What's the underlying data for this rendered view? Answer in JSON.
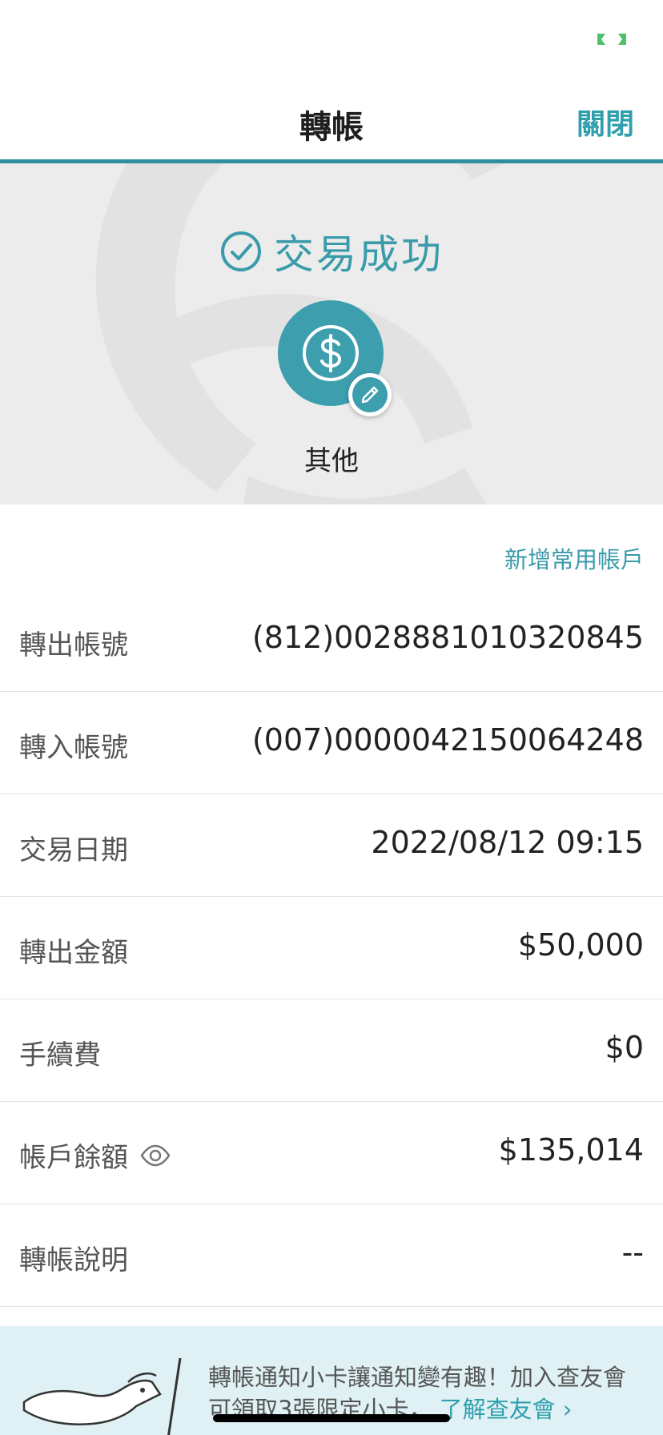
{
  "nav": {
    "title": "轉帳",
    "close_label": "關閉"
  },
  "hero": {
    "success_text": "交易成功",
    "category_label": "其他"
  },
  "add_account_link": "新增常用帳戶",
  "rows": [
    {
      "label": "轉出帳號",
      "value": "(812)0028881010320845"
    },
    {
      "label": "轉入帳號",
      "value": "(007)0000042150064248"
    },
    {
      "label": "交易日期",
      "value": "2022/08/12 09:15"
    },
    {
      "label": "轉出金額",
      "value": "$50,000"
    },
    {
      "label": "手續費",
      "value": "$0"
    },
    {
      "label": "帳戶餘額",
      "value": "$135,014"
    },
    {
      "label": "轉帳說明",
      "value": "--"
    }
  ],
  "promo": {
    "text": "轉帳通知小卡讓通知變有趣！加入查友會可領取3張限定小卡，",
    "link_label": "了解查友會 ›"
  },
  "colors": {
    "accent": "#3a9bab",
    "nav_line": "#2d8fa0",
    "hero_bg": "#ececec",
    "promo_bg": "#dff1f4"
  },
  "icons": [
    "signal-icon",
    "check-circle-icon",
    "dollar-icon",
    "pencil-icon",
    "eye-icon",
    "dog-illustration"
  ]
}
